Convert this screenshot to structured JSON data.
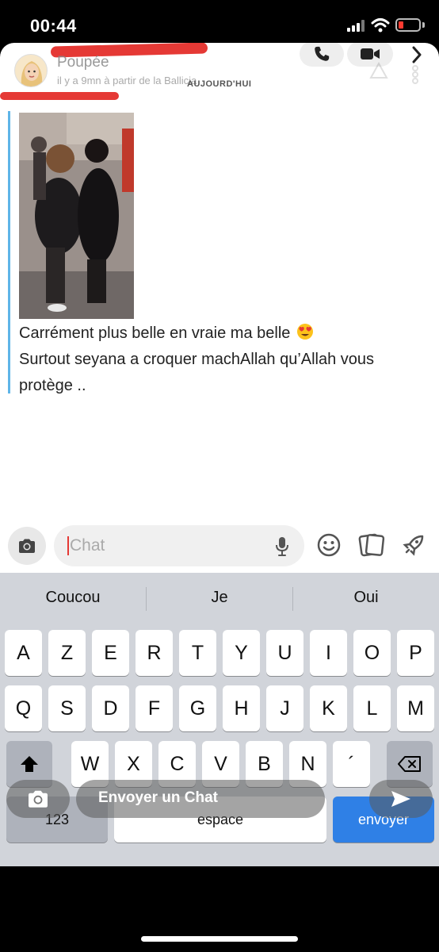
{
  "status_bar": {
    "time": "00:44"
  },
  "header": {
    "contact_name": "Poupée",
    "subtitle": "il y a 9mn à partir de la Ballicia",
    "day_label": "AUJOURD'HUI"
  },
  "message": {
    "photo_alt": "",
    "lines": [
      "Carrément plus belle en vraie ma belle",
      "Surtout seyana a croquer machAllah qu’Allah vous",
      "protège .."
    ],
    "accent_color": "#5fb5e8"
  },
  "input": {
    "placeholder": "Chat"
  },
  "suggestions": [
    "Coucou",
    "Je",
    "Oui"
  ],
  "keyboard": {
    "row1": [
      "A",
      "Z",
      "E",
      "R",
      "T",
      "Y",
      "U",
      "I",
      "O",
      "P"
    ],
    "row2": [
      "Q",
      "S",
      "D",
      "F",
      "G",
      "H",
      "J",
      "K",
      "L",
      "M"
    ],
    "row3": [
      "W",
      "X",
      "C",
      "V",
      "B",
      "N",
      "´"
    ],
    "numbers_label": "123",
    "space_label": "espace",
    "send_label": "envoyer"
  },
  "overlay": {
    "send_chat_label": "Envoyer un Chat"
  },
  "colors": {
    "send_key": "#2f80e6",
    "redaction": "#e53935",
    "battery_low": "#ff3b30"
  }
}
